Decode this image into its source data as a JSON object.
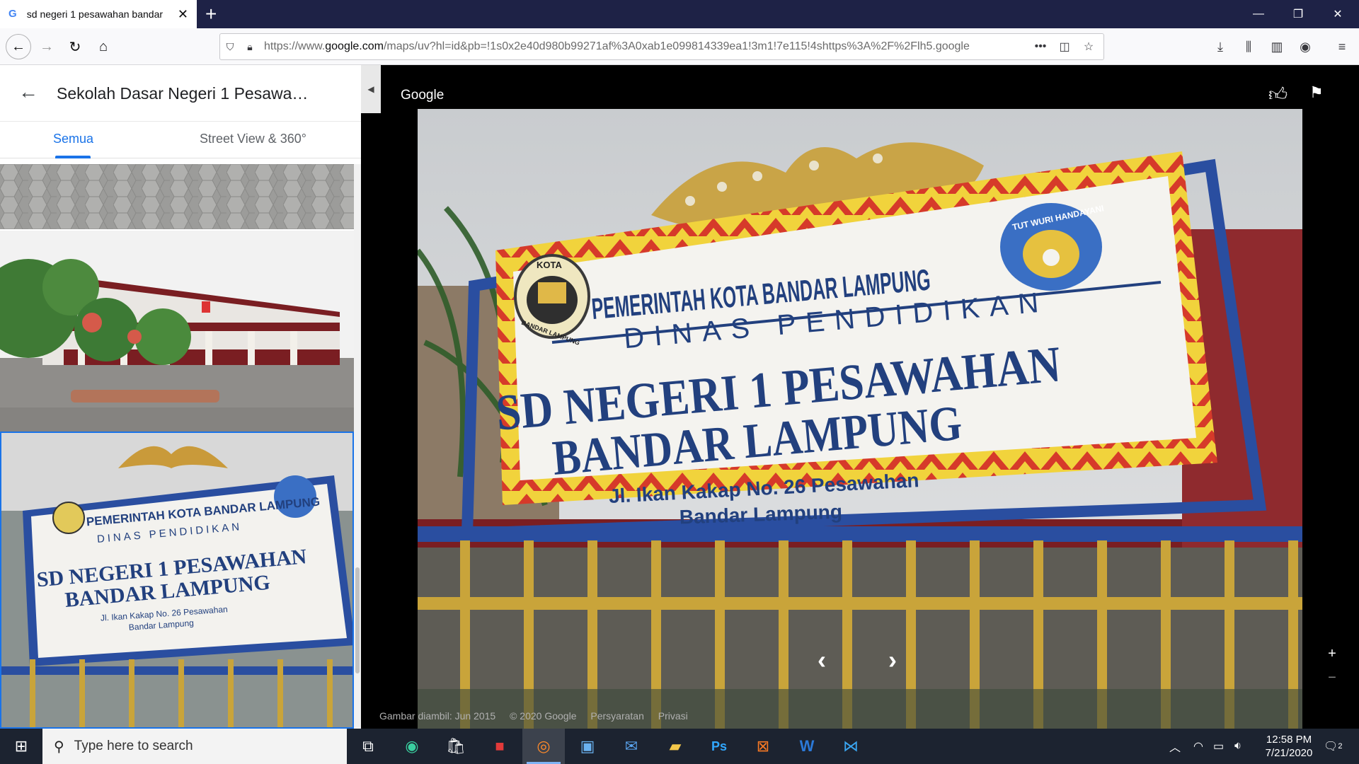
{
  "browser": {
    "tab_title": "sd negeri 1 pesawahan bandar",
    "url_prefix": "https://www.",
    "url_domain": "google.com",
    "url_rest": "/maps/uv?hl=id&pb=!1s0x2e40d980b99271af%3A0xab1e099814339ea1!3m1!7e115!4shttps%3A%2F%2Flh5.google"
  },
  "panel": {
    "title": "Sekolah Dasar Negeri 1 Pesawa…",
    "tabs": [
      "Semua",
      "Street View & 360°"
    ]
  },
  "viewer": {
    "brand": "Google",
    "sign": {
      "line1": "PEMERINTAH KOTA BANDAR LAMPUNG",
      "line2": "DINAS PENDIDIKAN",
      "line3": "SD NEGERI 1 PESAWAHAN",
      "line4": "BANDAR LAMPUNG",
      "line5": "Jl. Ikan Kakap No. 26 Pesawahan",
      "line6": "Bandar Lampung",
      "seal_left_top": "KOTA",
      "seal_left_bottom": "BANDAR LAMPUNG",
      "seal_right": "TUT WURI HANDAYANI"
    },
    "footer": {
      "date": "Gambar diambil: Jun 2015",
      "copyright": "© 2020 Google",
      "terms": "Persyaratan",
      "privacy": "Privasi"
    }
  },
  "taskbar": {
    "search_placeholder": "Type here to search",
    "time": "12:58 PM",
    "date": "7/21/2020",
    "notifications": "2"
  },
  "colors": {
    "accent": "#1a73e8",
    "taskbar": "#1c2330",
    "tabbar": "#1e2246",
    "sign_blue": "#2a4ea0"
  }
}
